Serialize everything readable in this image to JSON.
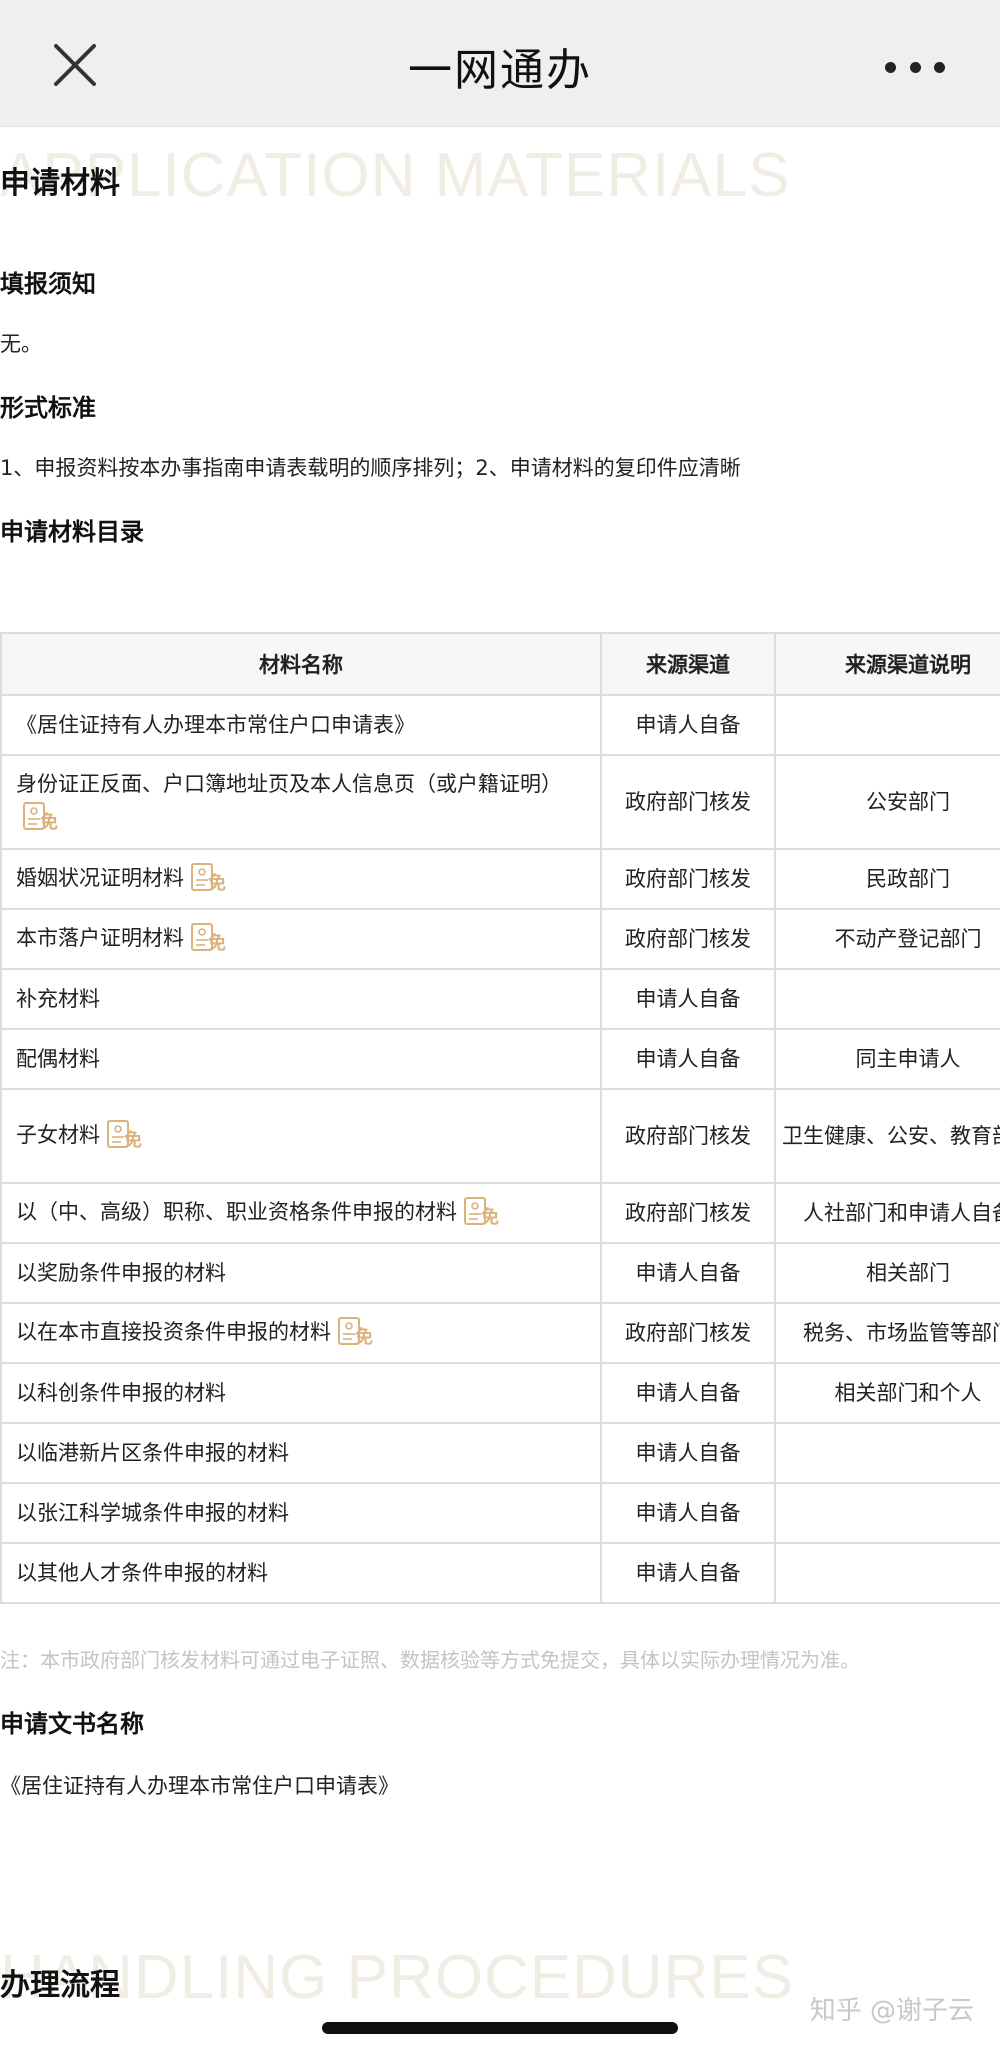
{
  "header": {
    "title": "一网通办"
  },
  "sections": {
    "materials_watermark": "APPLICATION MATERIALS",
    "materials_title": "申请材料",
    "fill_notice_title": "填报须知",
    "fill_notice_text": "无。",
    "format_title": "形式标准",
    "format_text": "1、申报资料按本办事指南申请表载明的顺序排列；2、申请材料的复印件应清晰",
    "catalog_title": "申请材料目录",
    "note": "注：本市政府部门核发材料可通过电子证照、数据核验等方式免提交，具体以实际办理情况为准。",
    "doc_name_title": "申请文书名称",
    "doc_name_text": "《居住证持有人办理本市常住户口申请表》",
    "procedures_watermark": "HANDLING PROCEDURES",
    "procedures_title": "办理流程"
  },
  "table": {
    "headers": [
      "材料名称",
      "来源渠道",
      "来源渠道说明"
    ],
    "badge_text": "免",
    "rows": [
      {
        "name": "《居住证持有人办理本市常住户口申请表》",
        "source": "申请人自备",
        "desc": "",
        "badge": false
      },
      {
        "name": "身份证正反面、户口簿地址页及本人信息页（或户籍证明）",
        "source": "政府部门核发",
        "desc": "公安部门",
        "badge": true
      },
      {
        "name": "婚姻状况证明材料",
        "source": "政府部门核发",
        "desc": "民政部门",
        "badge": true
      },
      {
        "name": "本市落户证明材料",
        "source": "政府部门核发",
        "desc": "不动产登记部门",
        "badge": true
      },
      {
        "name": "补充材料",
        "source": "申请人自备",
        "desc": "",
        "badge": false
      },
      {
        "name": "配偶材料",
        "source": "申请人自备",
        "desc": "同主申请人",
        "badge": false
      },
      {
        "name": "子女材料",
        "source": "政府部门核发",
        "desc": "卫生健康、公安、教育部门",
        "badge": true
      },
      {
        "name": "以（中、高级）职称、职业资格条件申报的材料",
        "source": "政府部门核发",
        "desc": "人社部门和申请人自备",
        "badge": true
      },
      {
        "name": "以奖励条件申报的材料",
        "source": "申请人自备",
        "desc": "相关部门",
        "badge": false
      },
      {
        "name": "以在本市直接投资条件申报的材料",
        "source": "政府部门核发",
        "desc": "税务、市场监管等部门",
        "badge": true
      },
      {
        "name": "以科创条件申报的材料",
        "source": "申请人自备",
        "desc": "相关部门和个人",
        "badge": false
      },
      {
        "name": "以临港新片区条件申报的材料",
        "source": "申请人自备",
        "desc": "",
        "badge": false
      },
      {
        "name": "以张江科学城条件申报的材料",
        "source": "申请人自备",
        "desc": "",
        "badge": false
      },
      {
        "name": "以其他人才条件申报的材料",
        "source": "申请人自备",
        "desc": "",
        "badge": false
      }
    ]
  },
  "watermark_credit": "知乎 @谢子云",
  "colors": {
    "topbar_bg": "#efefef",
    "badge": "#d9b27c",
    "watermark_text": "#f1ede4",
    "note_text": "#c4c4c4"
  }
}
